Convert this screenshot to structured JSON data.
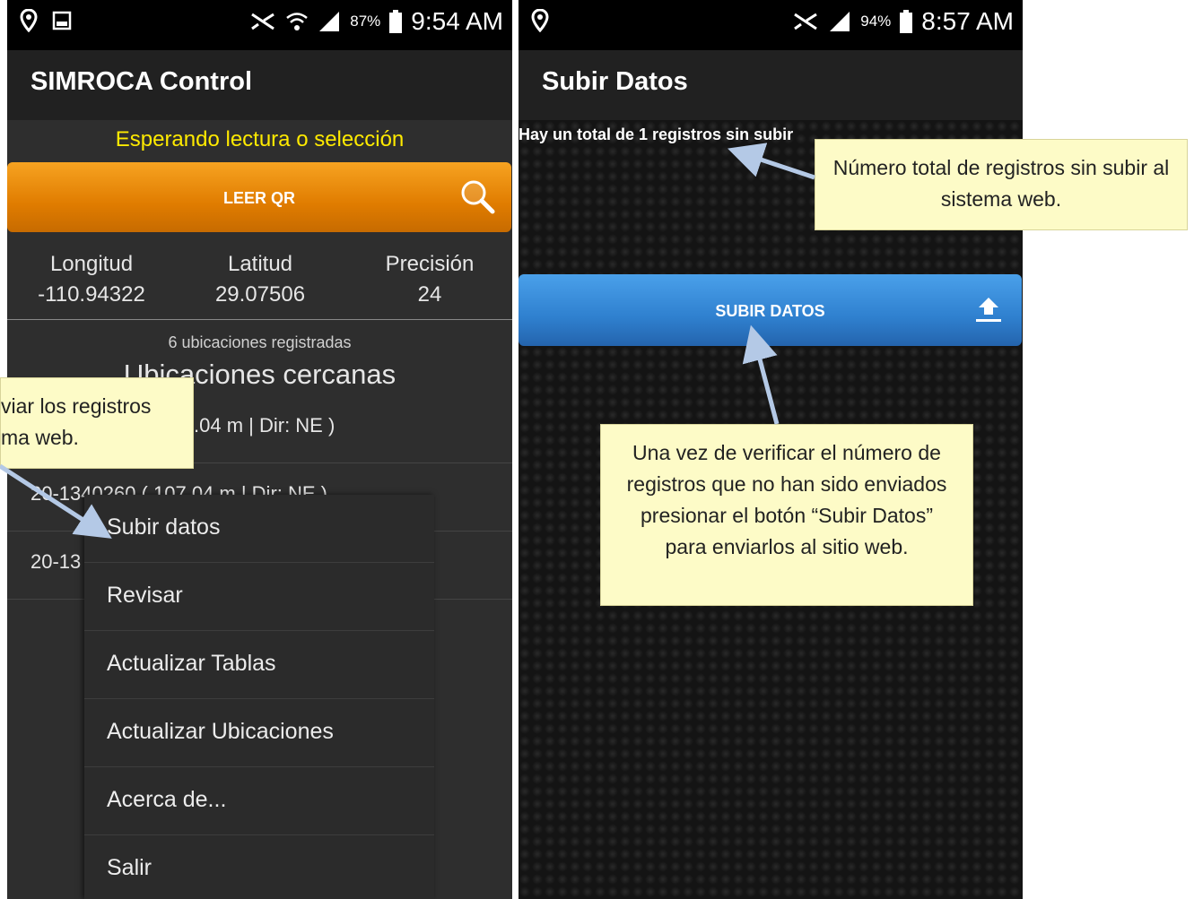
{
  "left_phone": {
    "status_time": "9:54 AM",
    "battery_pct": "87%",
    "app_title": "SIMROCA Control",
    "waiting_text": "Esperando lectura o selección",
    "qr_button_label": "LEER QR",
    "columns": [
      {
        "label": "Longitud",
        "value": "-110.94322"
      },
      {
        "label": "Latitud",
        "value": "29.07506"
      },
      {
        "label": "Precisión",
        "value": "24"
      }
    ],
    "registered_count": "6 ubicaciones registradas",
    "nearby_title": "Ubicaciones cercanas",
    "list_items": [
      ".04 m | Dir: NE )",
      "20-1340260 ( 107.04 m | Dir: NE )",
      "20-13"
    ],
    "menu_items": [
      "Subir datos",
      "Revisar",
      "Actualizar Tablas",
      "Actualizar Ubicaciones",
      "Acerca de...",
      "Salir"
    ],
    "callout_lines": [
      "viar los registros",
      "ma web."
    ]
  },
  "right_phone": {
    "status_time": "8:57 AM",
    "battery_pct": "94%",
    "screen_title": "Subir Datos",
    "total_text": "Hay un total de 1 registros sin subir",
    "upload_button_label": "SUBIR DATOS",
    "callout_top": "Número total de registros sin subir al sistema web.",
    "callout_bottom": "Una vez de verificar el número de registros que no han sido enviados presionar el botón “Subir Datos” para enviarlos al sitio web."
  },
  "colors": {
    "accent_orange": "#e88a10",
    "accent_blue": "#2f80cf",
    "waiting_yellow": "#ffea00",
    "callout_bg": "#fdfbc7"
  }
}
